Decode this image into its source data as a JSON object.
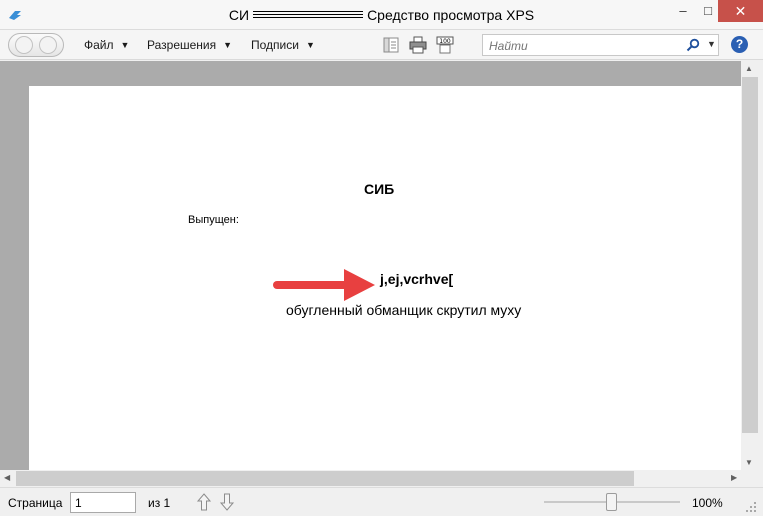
{
  "window": {
    "title_left": "СИ",
    "title_right": "Средство просмотра XPS",
    "minimize_glyph": "–",
    "maximize_glyph": "□",
    "close_glyph": "✕"
  },
  "toolbar": {
    "menus": [
      {
        "label": "Файл"
      },
      {
        "label": "Разрешения"
      },
      {
        "label": "Подписи"
      }
    ],
    "search_placeholder": "Найти",
    "help_glyph": "?",
    "icons": [
      "outline-icon",
      "print-icon",
      "zoom-100-icon",
      "search-icon",
      "help-icon"
    ]
  },
  "document": {
    "title": "СИБ",
    "issued_label": "Выпущен:",
    "code_text": "j,ej,vcrhve[",
    "phrase": "обугленный обманщик скрутил муху"
  },
  "statusbar": {
    "page_label": "Страница",
    "page_value": "1",
    "of_label": "из 1",
    "zoom_level": "100%"
  },
  "colors": {
    "close_button": "#c7514a",
    "arrow": "#e84040",
    "help": "#2a5fb3"
  }
}
